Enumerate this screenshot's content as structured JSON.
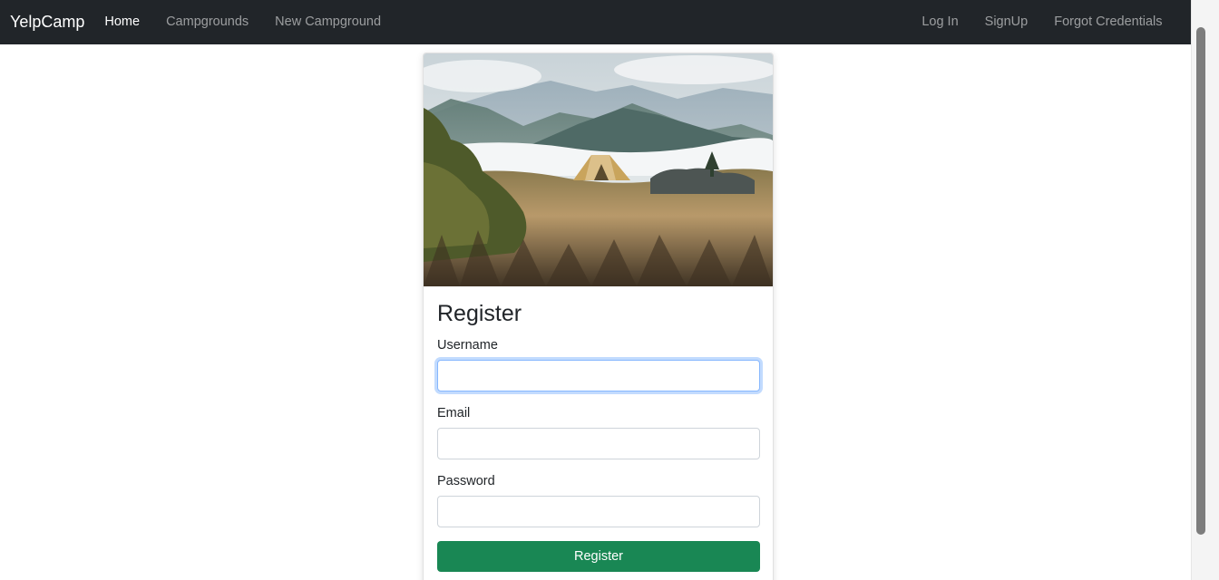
{
  "navbar": {
    "brand": "YelpCamp",
    "left_links": [
      {
        "label": "Home",
        "active": true
      },
      {
        "label": "Campgrounds",
        "active": false
      },
      {
        "label": "New Campground",
        "active": false
      }
    ],
    "right_links": [
      {
        "label": "Log In"
      },
      {
        "label": "SignUp"
      },
      {
        "label": "Forgot Credentials"
      }
    ]
  },
  "card": {
    "image_alt": "tent-in-mountains-photo",
    "title": "Register",
    "fields": {
      "username": {
        "label": "Username",
        "value": "",
        "placeholder": ""
      },
      "email": {
        "label": "Email",
        "value": "",
        "placeholder": ""
      },
      "password": {
        "label": "Password",
        "value": "",
        "placeholder": ""
      }
    },
    "submit_label": "Register"
  },
  "colors": {
    "navbar_bg": "#212529",
    "submit_bg": "#198754",
    "focus_ring": "#86b7fe"
  }
}
